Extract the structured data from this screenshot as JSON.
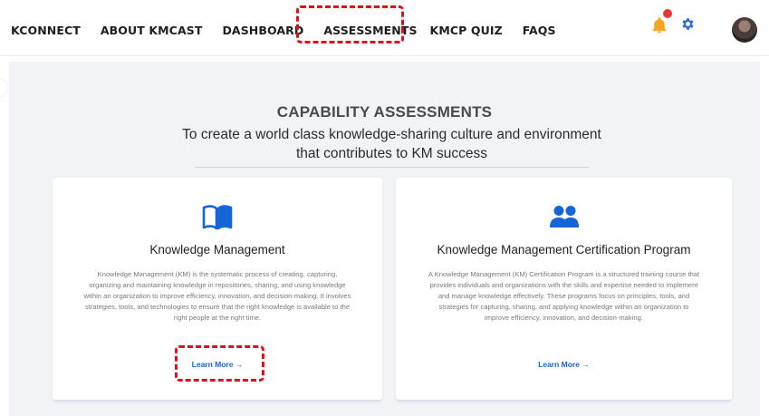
{
  "nav": {
    "items": [
      "KCONNECT",
      "ABOUT KMCAST",
      "DASHBOARD",
      "ASSESSMENTS",
      "KMCP QUIZ",
      "FAQS"
    ],
    "active_index": 3
  },
  "header": {
    "bell_icon": "bell-icon",
    "settings_icon": "gear-icon",
    "avatar": "user-avatar"
  },
  "hero": {
    "title": "CAPABILITY ASSESSMENTS",
    "subtitle": "To create a world class knowledge-sharing culture and environment that contributes to KM success"
  },
  "cards": [
    {
      "icon": "open-book-icon",
      "title": "Knowledge Management",
      "description": "Knowledge Management (KM) is the systematic process of creating, capturing, organizing and maintaining knowledge in repositories, sharing, and using knowledge within an organization to improve efficiency, innovation, and decision-making. It involves strategies, tools, and technologies to ensure that the right knowledge is available to the right people at the right time.",
      "link": "Learn More →"
    },
    {
      "icon": "users-icon",
      "title": "Knowledge Management Certification Program",
      "description": "A Knowledge Management (KM) Certification Program is a structured training course that provides individuals and organizations with the skills and expertise needed to implement and manage knowledge effectively. These programs focus on principles, tools, and strategies for capturing, sharing, and applying knowledge within an organization to improve efficiency, innovation, and decision-making.",
      "link": "Learn More →"
    }
  ],
  "colors": {
    "accent": "#1565d8",
    "highlight": "#e0101b",
    "notification": "#e53935",
    "bell": "#f5a623",
    "background": "#f1f3f6"
  }
}
